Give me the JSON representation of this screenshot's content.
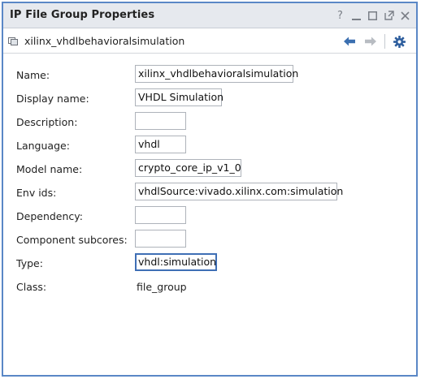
{
  "window": {
    "title": "IP File Group Properties",
    "controls": {
      "help": "?",
      "minimize": "—",
      "maximize": "□",
      "float": "⧉",
      "close": "✕"
    }
  },
  "toolbar": {
    "object_name": "xilinx_vhdlbehavioralsimulation"
  },
  "properties": [
    {
      "label": "Name:",
      "value": "xilinx_vhdlbehavioralsimulation"
    },
    {
      "label": "Display name:",
      "value": "VHDL Simulation"
    },
    {
      "label": "Description:",
      "value": ""
    },
    {
      "label": "Language:",
      "value": "vhdl"
    },
    {
      "label": "Model name:",
      "value": "crypto_core_ip_v1_0"
    },
    {
      "label": "Env ids:",
      "value": "vhdlSource:vivado.xilinx.com:simulation"
    },
    {
      "label": "Dependency:",
      "value": ""
    },
    {
      "label": "Component subcores:",
      "value": ""
    },
    {
      "label": "Type:",
      "value": "vhdl:simulation"
    },
    {
      "label": "Class:",
      "value": "file_group"
    }
  ],
  "colors": {
    "window_border": "#5a87c6",
    "titlebar_bg": "#e6e9ee",
    "focus_border": "#3f6fb5",
    "nav_arrow_active": "#3b6fb0",
    "nav_arrow_disabled": "#b8bcc2",
    "gear": "#2f5f9e"
  }
}
